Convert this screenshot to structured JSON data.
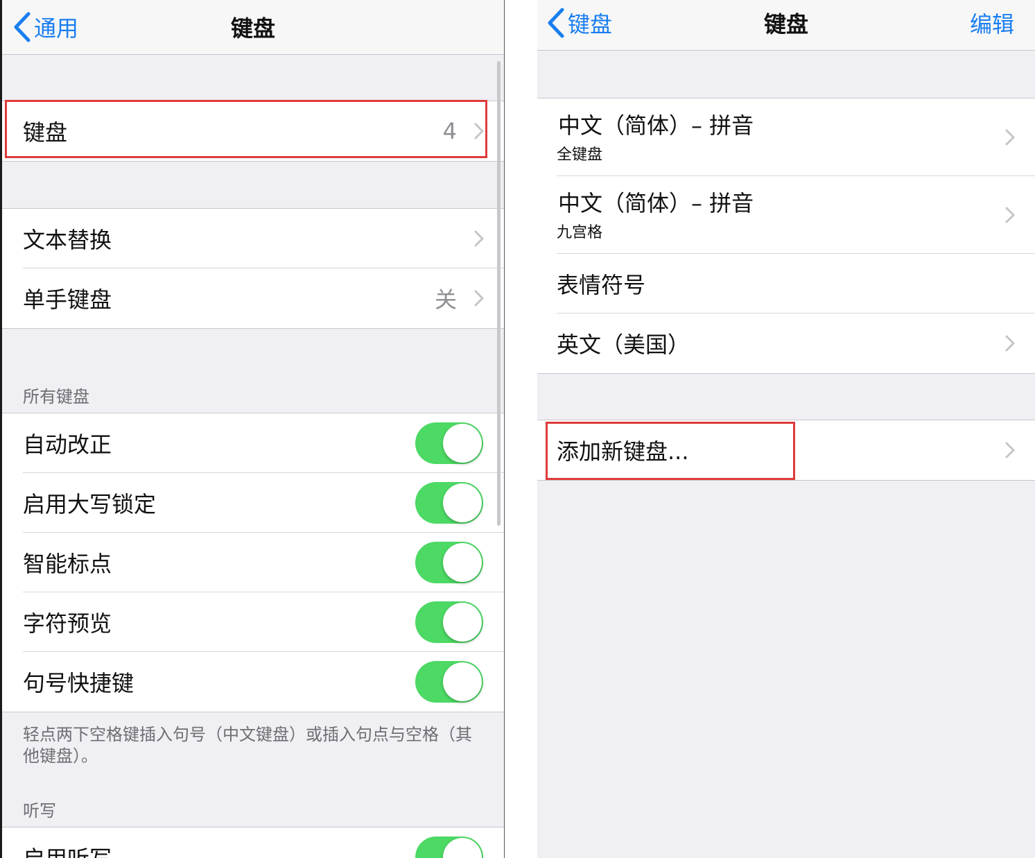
{
  "left": {
    "nav": {
      "back_label": "通用",
      "title": "键盘"
    },
    "keyboards_row": {
      "label": "键盘",
      "value": "4"
    },
    "group2": [
      {
        "label": "文本替换",
        "value": ""
      },
      {
        "label": "单手键盘",
        "value": "关"
      }
    ],
    "all_keyboards": {
      "header": "所有键盘",
      "toggles": [
        {
          "label": "自动改正",
          "on": true
        },
        {
          "label": "启用大写锁定",
          "on": true
        },
        {
          "label": "智能标点",
          "on": true
        },
        {
          "label": "字符预览",
          "on": true
        },
        {
          "label": "句号快捷键",
          "on": true
        }
      ],
      "footer": "轻点两下空格键插入句号（中文键盘）或插入句点与空格（其他键盘）。"
    },
    "dictation": {
      "header": "听写",
      "toggle_label": "启用听写",
      "on": true
    }
  },
  "right": {
    "nav": {
      "back_label": "键盘",
      "title": "键盘",
      "action": "编辑"
    },
    "keyboards": [
      {
        "label": "中文（简体）– 拼音",
        "sub": "全键盘",
        "chevron": true
      },
      {
        "label": "中文（简体）– 拼音",
        "sub": "九宫格",
        "chevron": true
      },
      {
        "label": "表情符号",
        "sub": "",
        "chevron": false
      },
      {
        "label": "英文（美国）",
        "sub": "",
        "chevron": true
      }
    ],
    "add_keyboard": {
      "label": "添加新键盘..."
    }
  },
  "colors": {
    "accent": "#1a7ef0",
    "toggle_on": "#4cd964",
    "highlight": "#e03a3a",
    "background": "#efeff4"
  }
}
